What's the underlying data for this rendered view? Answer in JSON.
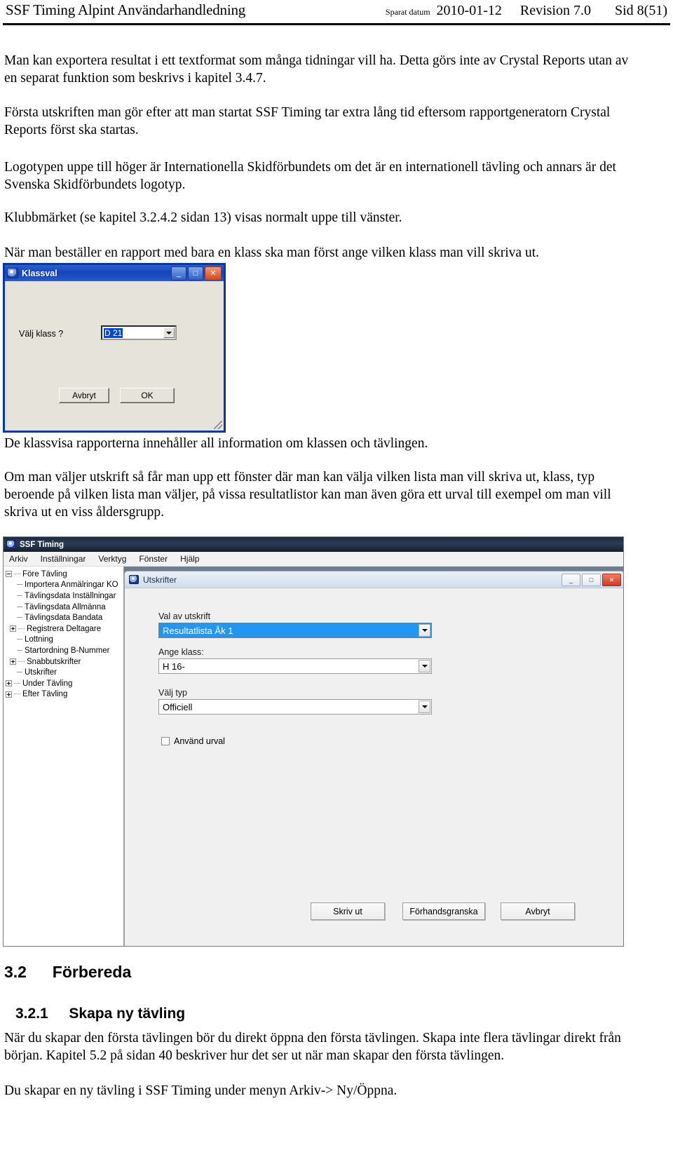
{
  "header": {
    "title": "SSF Timing Alpint Användarhandledning",
    "saved_label": "Sparat datum",
    "saved_date": "2010-01-12",
    "revision": "Revision 7.0",
    "page": "Sid 8(51)"
  },
  "paragraphs": {
    "p1": "Man kan exportera resultat i ett textformat som många tidningar vill ha. Detta görs inte av Crystal Reports utan av en separat funktion som beskrivs i kapitel 3.4.7.",
    "p2": "Första utskriften man gör efter att man startat SSF Timing tar extra lång tid eftersom rapportgeneratorn Crystal Reports först ska startas.",
    "p3": "Logotypen uppe till höger är Internationella Skidförbundets om det är en internationell tävling och annars är det Svenska Skidförbundets logotyp.",
    "p4": "Klubbmärket (se kapitel 3.2.4.2 sidan 13) visas normalt uppe till vänster.",
    "p5": "När man beställer en rapport med bara en klass ska man först ange vilken klass man vill skriva ut.",
    "p6": "De klassvisa rapporterna innehåller all information om klassen och tävlingen.",
    "p7": "Om man väljer utskrift så får man upp ett fönster där man kan välja vilken lista man vill skriva ut, klass, typ beroende på vilken lista man väljer, på vissa resultatlistor kan man även göra ett urval till exempel om man vill skriva ut en viss åldersgrupp.",
    "p8": "När du skapar den första tävlingen bör du direkt öppna den första tävlingen. Skapa inte flera tävlingar direkt från början. Kapitel 5.2 på sidan 40 beskriver hur det ser ut när man skapar den första tävlingen.",
    "p9": "Du skapar en ny tävling i SSF Timing under menyn Arkiv-> Ny/Öppna."
  },
  "klassval_dialog": {
    "title": "Klassval",
    "minimize_label": "_",
    "maximize_label": "□",
    "close_label": "✕",
    "field_label": "Välj klass  ?",
    "combo_value": "D 21",
    "cancel_label": "Avbryt",
    "ok_label": "OK"
  },
  "ssf_window": {
    "title": "SSF Timing",
    "menu": [
      "Arkiv",
      "Inställningar",
      "Verktyg",
      "Fönster",
      "Hjälp"
    ],
    "tree": [
      {
        "label": "Före Tävling",
        "level": 0,
        "state": "expanded"
      },
      {
        "label": "Importera Anmälringar KO",
        "level": 1,
        "state": "leaf"
      },
      {
        "label": "Tävlingsdata Inställningar",
        "level": 1,
        "state": "leaf"
      },
      {
        "label": "Tävlingsdata Allmänna",
        "level": 1,
        "state": "leaf"
      },
      {
        "label": "Tävlingsdata Bandata",
        "level": 1,
        "state": "leaf"
      },
      {
        "label": "Registrera Deltagare",
        "level": 1,
        "state": "collapsed"
      },
      {
        "label": "Lottning",
        "level": 1,
        "state": "leaf"
      },
      {
        "label": "Startordning B-Nummer",
        "level": 1,
        "state": "leaf"
      },
      {
        "label": "Snabbutskrifter",
        "level": 1,
        "state": "collapsed"
      },
      {
        "label": "Utskrifter",
        "level": 1,
        "state": "leaf"
      },
      {
        "label": "Under Tävling",
        "level": 0,
        "state": "collapsed"
      },
      {
        "label": "Efter Tävling",
        "level": 0,
        "state": "collapsed"
      }
    ],
    "utskrifter_dialog": {
      "title": "Utskrifter",
      "minimize_label": "_",
      "maximize_label": "□",
      "close_label": "✕",
      "field1_label": "Val av utskrift",
      "field1_value": "Resultatlista Åk 1",
      "field2_label": "Ange klass:",
      "field2_value": "H 16-",
      "field3_label": "Välj typ",
      "field3_value": "Officiell",
      "checkbox_label": "Använd urval",
      "checkbox_checked": false,
      "print_label": "Skriv ut",
      "preview_label": "Förhandsgranska",
      "cancel_label": "Avbryt"
    }
  },
  "headings": {
    "h2_number": "3.2",
    "h2_text": "Förbereda",
    "h3_number": "3.2.1",
    "h3_text": "Skapa ny tävling"
  },
  "colors": {
    "accent_blue": "#2196f3",
    "titlebar_blue": "#1346bd",
    "dialog_face": "#e6e4da",
    "window_face": "#f0f0f0"
  }
}
